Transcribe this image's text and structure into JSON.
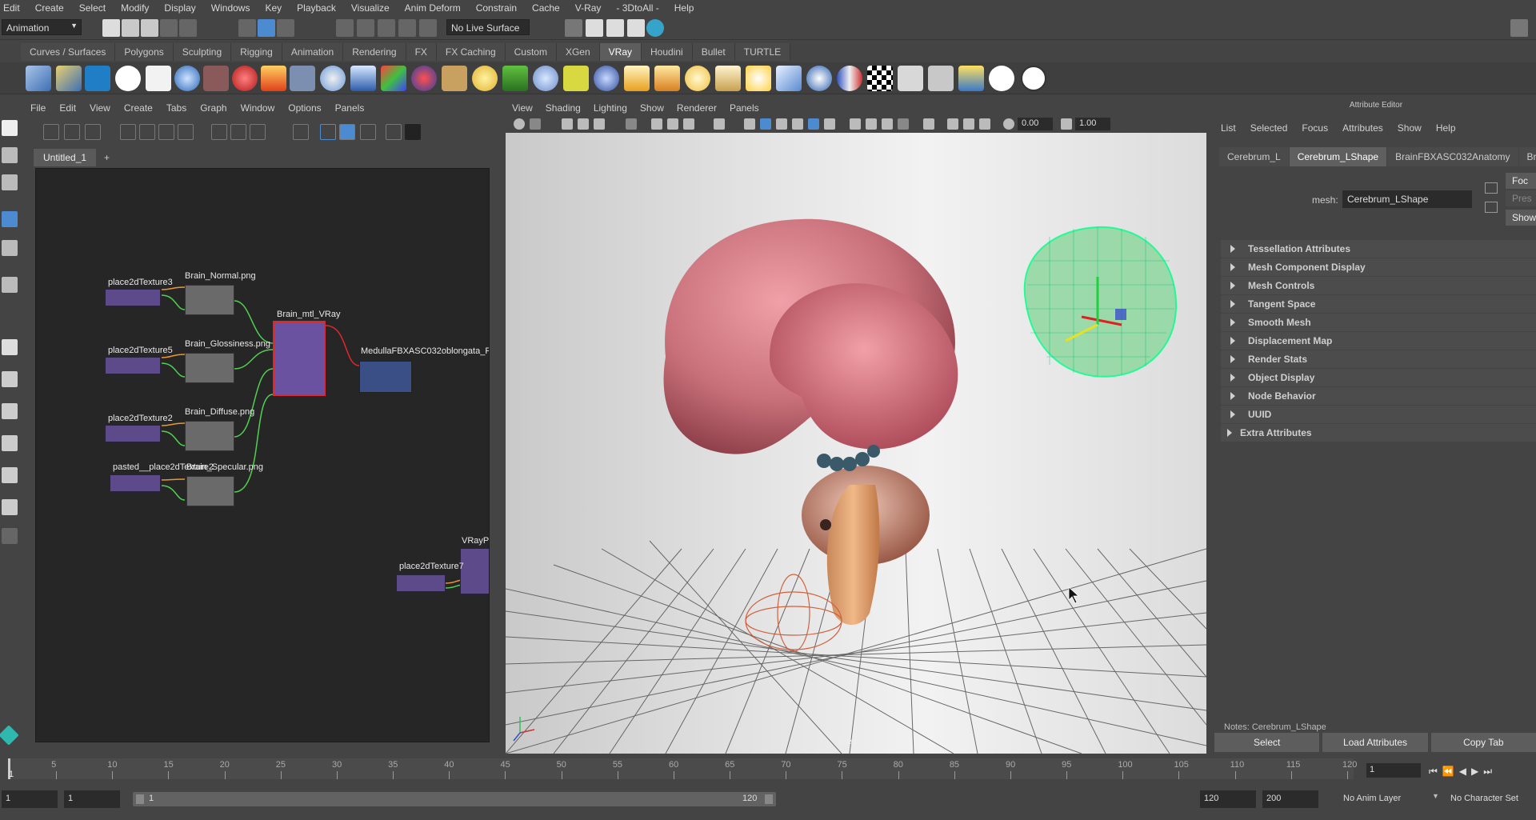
{
  "menubar": [
    "Edit",
    "Create",
    "Select",
    "Modify",
    "Display",
    "Windows",
    "Key",
    "Playback",
    "Visualize",
    "Anim Deform",
    "Constrain",
    "Cache",
    "V-Ray",
    "- 3DtoAll -",
    "Help"
  ],
  "status": {
    "menuset": "Animation",
    "live_surface": "No Live Surface"
  },
  "shelf_tabs": [
    "Curves / Surfaces",
    "Polygons",
    "Sculpting",
    "Rigging",
    "Animation",
    "Rendering",
    "FX",
    "FX Caching",
    "Custom",
    "XGen",
    "VRay",
    "Houdini",
    "Bullet",
    "TURTLE"
  ],
  "active_shelf_tab": "VRay",
  "hypershade": {
    "menu": [
      "File",
      "Edit",
      "View",
      "Create",
      "Tabs",
      "Graph",
      "Window",
      "Options",
      "Panels"
    ],
    "tabs": [
      "Untitled_1",
      "+"
    ],
    "nodes": {
      "p2d3": "place2dTexture3",
      "normal": "Brain_Normal.png",
      "p2d5": "place2dTexture5",
      "gloss": "Brain_Glossiness.png",
      "p2d2": "place2dTexture2",
      "diffuse": "Brain_Diffuse.png",
      "pasted": "pasted__place2dTexture2",
      "specular": "Brain_Specular.png",
      "material": "Brain_mtl_VRay",
      "sg": "MedullaFBXASC032oblongata_P",
      "vrayp": "VRayP",
      "p2d7": "place2dTexture7"
    }
  },
  "viewport": {
    "menu": [
      "View",
      "Shading",
      "Lighting",
      "Show",
      "Renderer",
      "Panels"
    ],
    "exposure": "0.00",
    "gamma": "1.00",
    "camera": "persp"
  },
  "attribute_editor": {
    "title": "Attribute Editor",
    "menu": [
      "List",
      "Selected",
      "Focus",
      "Attributes",
      "Show",
      "Help"
    ],
    "tabs": [
      "Cerebrum_L",
      "Cerebrum_LShape",
      "BrainFBXASC032Anatomy",
      "Bra"
    ],
    "active_tab": "Cerebrum_LShape",
    "mesh_label": "mesh:",
    "mesh_value": "Cerebrum_LShape",
    "side_buttons": [
      "Foc",
      "Pres",
      "Show"
    ],
    "sections": [
      "Tessellation Attributes",
      "Mesh Component Display",
      "Mesh Controls",
      "Tangent Space",
      "Smooth Mesh",
      "Displacement Map",
      "Render Stats",
      "Object Display",
      "Node Behavior",
      "UUID",
      "Extra Attributes"
    ],
    "notes": "Notes:  Cerebrum_LShape",
    "buttons": [
      "Select",
      "Load Attributes",
      "Copy Tab"
    ]
  },
  "timeline": {
    "ticks": [
      "5",
      "10",
      "15",
      "20",
      "25",
      "30",
      "35",
      "40",
      "45",
      "50",
      "55",
      "60",
      "65",
      "70",
      "75",
      "80",
      "85",
      "90",
      "95",
      "100",
      "105",
      "110",
      "115",
      "120"
    ],
    "start_label": "1",
    "current_frame": "1"
  },
  "range": {
    "start": "1",
    "playback_start": "1",
    "bar_start": "1",
    "bar_end": "120",
    "playback_end": "120",
    "end": "200",
    "anim_layer": "No Anim Layer",
    "character_set": "No Character Set"
  }
}
